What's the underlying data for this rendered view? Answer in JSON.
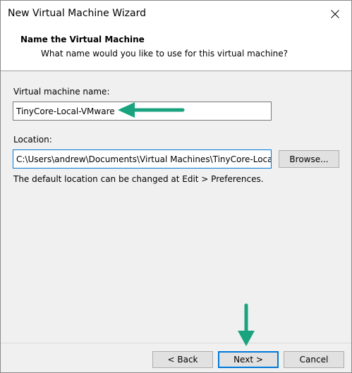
{
  "window": {
    "title": "New Virtual Machine Wizard"
  },
  "header": {
    "title": "Name the Virtual Machine",
    "subtitle": "What name would you like to use for this virtual machine?"
  },
  "form": {
    "vm_name_label": "Virtual machine name:",
    "vm_name_value": "TinyCore-Local-VMware",
    "location_label": "Location:",
    "location_value": "C:\\Users\\andrew\\Documents\\Virtual Machines\\TinyCore-Local-",
    "browse_label": "Browse...",
    "hint": "The default location can be changed at Edit > Preferences."
  },
  "footer": {
    "back_label": "< Back",
    "next_label": "Next >",
    "cancel_label": "Cancel"
  },
  "icons": {
    "close": "close-icon",
    "annotation_arrow": "arrow-icon"
  },
  "colors": {
    "accent": "#0078d7",
    "annotation_arrow": "#1aa37f"
  }
}
